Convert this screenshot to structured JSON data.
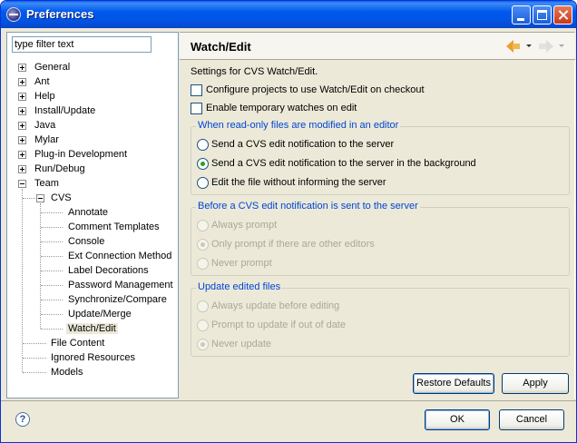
{
  "window": {
    "title": "Preferences"
  },
  "filter": {
    "value": "type filter text"
  },
  "tree": [
    {
      "label": "General",
      "expander": "plus"
    },
    {
      "label": "Ant",
      "expander": "plus"
    },
    {
      "label": "Help",
      "expander": "plus"
    },
    {
      "label": "Install/Update",
      "expander": "plus"
    },
    {
      "label": "Java",
      "expander": "plus"
    },
    {
      "label": "Mylar",
      "expander": "plus"
    },
    {
      "label": "Plug-in Development",
      "expander": "plus"
    },
    {
      "label": "Run/Debug",
      "expander": "plus"
    },
    {
      "label": "Team",
      "expander": "minus"
    },
    {
      "label": "CVS",
      "expander": "minus"
    },
    {
      "label": "Annotate"
    },
    {
      "label": "Comment Templates"
    },
    {
      "label": "Console"
    },
    {
      "label": "Ext Connection Method"
    },
    {
      "label": "Label Decorations"
    },
    {
      "label": "Password Management"
    },
    {
      "label": "Synchronize/Compare"
    },
    {
      "label": "Update/Merge"
    },
    {
      "label": "Watch/Edit",
      "selected": true
    },
    {
      "label": "File Content"
    },
    {
      "label": "Ignored Resources"
    },
    {
      "label": "Models"
    }
  ],
  "page": {
    "title": "Watch/Edit",
    "description": "Settings for CVS Watch/Edit.",
    "checkboxes": [
      {
        "label": "Configure projects to use Watch/Edit on checkout",
        "checked": false
      },
      {
        "label": "Enable temporary watches on edit",
        "checked": false
      }
    ],
    "groups": [
      {
        "title": "When read-only files are modified in an editor",
        "enabled": true,
        "options": [
          {
            "label": "Send a CVS edit notification to the server",
            "selected": false
          },
          {
            "label": "Send a CVS edit notification to the server in the background",
            "selected": true
          },
          {
            "label": "Edit the file without informing the server",
            "selected": false
          }
        ]
      },
      {
        "title": "Before a CVS edit notification is sent to the server",
        "enabled": false,
        "options": [
          {
            "label": "Always prompt",
            "selected": false
          },
          {
            "label": "Only prompt if there are other editors",
            "selected": true
          },
          {
            "label": "Never prompt",
            "selected": false
          }
        ]
      },
      {
        "title": "Update edited files",
        "enabled": false,
        "options": [
          {
            "label": "Always update before editing",
            "selected": false
          },
          {
            "label": "Prompt to update if out of date",
            "selected": false
          },
          {
            "label": "Never update",
            "selected": true
          }
        ]
      }
    ],
    "restore_defaults": "Restore Defaults",
    "apply": "Apply"
  },
  "footer": {
    "help": "?",
    "ok": "OK",
    "cancel": "Cancel"
  }
}
